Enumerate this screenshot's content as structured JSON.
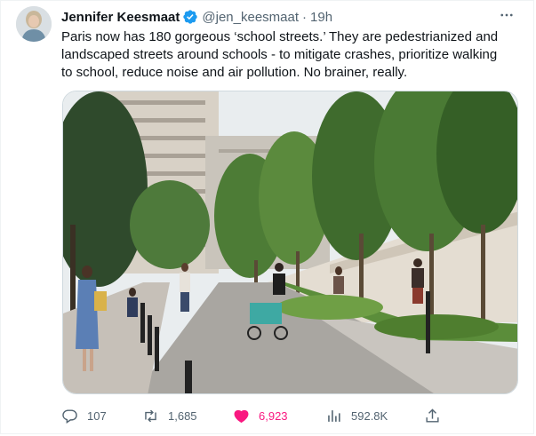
{
  "tweet": {
    "author_name": "Jennifer Keesmaat",
    "handle": "@jen_keesmaat",
    "separator": "·",
    "time": "19h",
    "text": "Paris now has 180 gorgeous ‘school streets.’ They are pedestrianized and landscaped streets around schools - to mitigate crashes, prioritize walking to school, reduce noise and air pollution.  No brainer, really.",
    "more_icon": "more-horizontal-icon",
    "verified_icon": "verified-badge-icon",
    "verified_color": "#1d9bf0"
  },
  "actions": {
    "reply": {
      "icon": "reply-icon",
      "count": "107"
    },
    "retweet": {
      "icon": "retweet-icon",
      "count": "1,685"
    },
    "like": {
      "icon": "heart-icon",
      "count": "6,923",
      "color": "#f91880",
      "active": true
    },
    "views": {
      "icon": "views-icon",
      "count": "592.8K"
    },
    "share": {
      "icon": "share-icon"
    }
  }
}
